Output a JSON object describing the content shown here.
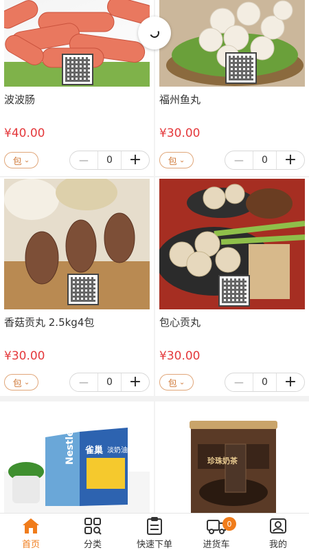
{
  "products": [
    {
      "name": "波波肠",
      "price": "¥40.00",
      "unit": "包",
      "qty": "0"
    },
    {
      "name": "福州鱼丸",
      "price": "¥30.00",
      "unit": "包",
      "qty": "0"
    },
    {
      "name": "香菇贡丸 2.5kg4包",
      "price": "¥30.00",
      "unit": "包",
      "qty": "0"
    },
    {
      "name": "包心贡丸",
      "price": "¥30.00",
      "unit": "包",
      "qty": "0"
    }
  ],
  "product_images": {
    "nestle_box_text": "淡奶油",
    "nestle_brand": "Nestle",
    "nestle_cn": "雀巢",
    "powder_label": "珍珠奶茶"
  },
  "stepper": {
    "minus": "−",
    "plus": "+"
  },
  "tabbar": {
    "cart_badge": "0",
    "items": [
      {
        "label": "首页",
        "icon": "home-icon"
      },
      {
        "label": "分类",
        "icon": "category-icon"
      },
      {
        "label": "快速下单",
        "icon": "clipboard-icon"
      },
      {
        "label": "进货车",
        "icon": "truck-icon"
      },
      {
        "label": "我的",
        "icon": "profile-icon"
      }
    ]
  },
  "colors": {
    "accent": "#f07c1b",
    "price": "#e4393c"
  }
}
